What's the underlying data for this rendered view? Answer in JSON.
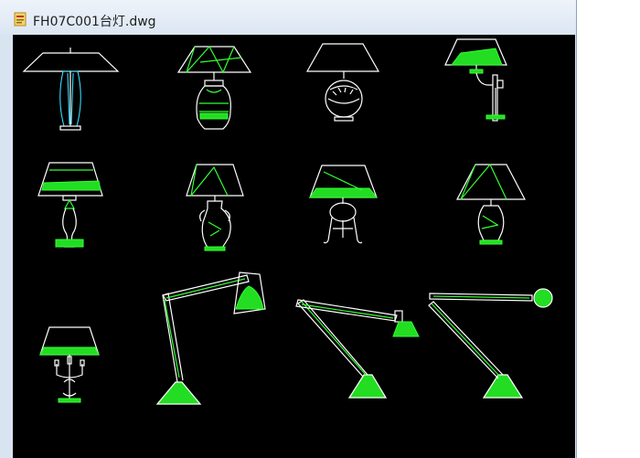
{
  "window": {
    "title": "FH07C001台灯.dwg",
    "file_icon": "dwg-file-icon"
  },
  "drawing": {
    "background": "#000000",
    "line_colors": {
      "outline": "#ffffff",
      "detail": "#33ff33",
      "accent": "#33ddff"
    },
    "lamps": [
      "table-lamp-1",
      "table-lamp-2",
      "table-lamp-3",
      "wall-lamp-4",
      "table-lamp-5",
      "table-lamp-6",
      "table-lamp-7",
      "table-lamp-8",
      "candle-lamp-9",
      "desk-lamp-10",
      "desk-lamp-11",
      "desk-lamp-12"
    ]
  }
}
